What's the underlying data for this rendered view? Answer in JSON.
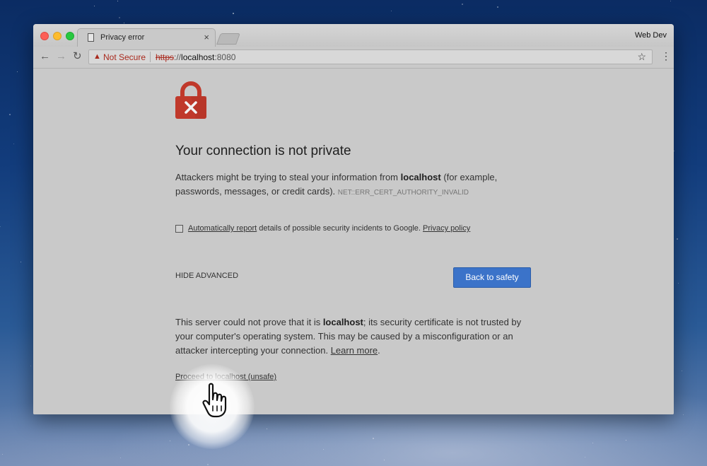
{
  "browser": {
    "profile": "Web Dev",
    "tab": {
      "title": "Privacy error",
      "close_glyph": "×"
    },
    "toolbar": {
      "back_glyph": "←",
      "forward_glyph": "→",
      "reload_glyph": "↻",
      "security_label": "Not Secure",
      "url_scheme": "https",
      "url_sep": "://",
      "url_host": "localhost",
      "url_port": ":8080",
      "bookmark_glyph": "☆",
      "menu_glyph": "⋮"
    }
  },
  "page": {
    "heading": "Your connection is not private",
    "intro_pre": "Attackers might be trying to steal your information from ",
    "intro_host": "localhost",
    "intro_post": " (for example, passwords, messages, or credit cards). ",
    "error_code": "NET::ERR_CERT_AUTHORITY_INVALID",
    "report_link": "Automatically report",
    "report_text": " details of possible security incidents to Google. ",
    "privacy_link": "Privacy policy",
    "hide_advanced": "HIDE ADVANCED",
    "back_to_safety": "Back to safety",
    "details_pre": "This server could not prove that it is ",
    "details_host": "localhost",
    "details_post": "; its security certificate is not trusted by your computer's operating system. This may be caused by a misconfiguration or an attacker intercepting your connection. ",
    "learn_more": "Learn more",
    "details_end": ".",
    "proceed_link": "Proceed to localhost (unsafe)"
  },
  "colors": {
    "danger": "#a92a1e",
    "lock": "#c0392b",
    "button": "#3b73c9",
    "page_bg": "#c9c9c9"
  },
  "icons": [
    "document-icon",
    "warning-icon",
    "lock-error-icon",
    "hand-cursor-icon"
  ]
}
